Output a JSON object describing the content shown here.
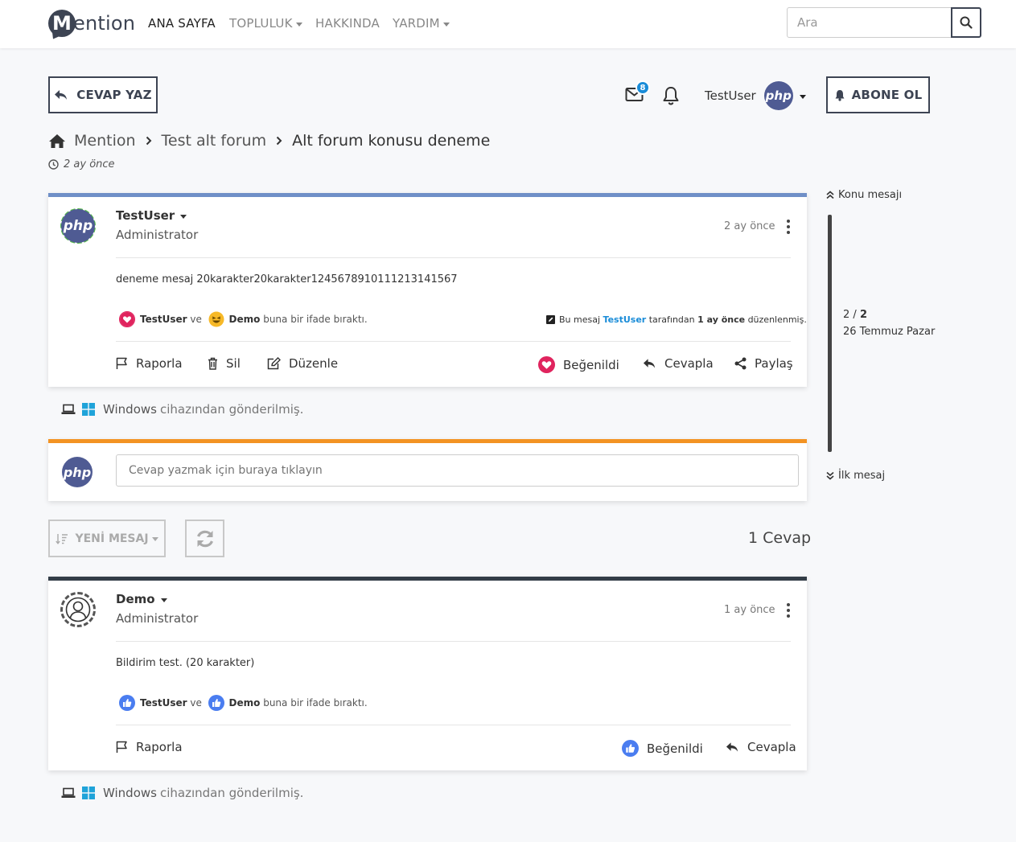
{
  "nav": {
    "logo": "Mention",
    "items": [
      "ANA SAYFA",
      "TOPLULUK",
      "HAKKINDA",
      "YARDIM"
    ],
    "search_placeholder": "Ara"
  },
  "header": {
    "reply_button": "CEVAP YAZ",
    "message_count": "8",
    "username": "TestUser",
    "subscribe_button": "ABONE OL"
  },
  "breadcrumb": {
    "home": "Mention",
    "forum": "Test alt forum",
    "topic": "Alt forum konusu deneme",
    "time": "2 ay önce"
  },
  "posts": [
    {
      "user": "TestUser",
      "role": "Administrator",
      "avatar_text": "php",
      "time": "2 ay önce",
      "text": "deneme mesaj 20karakter20karakter1245678910111213141567",
      "react_user1": "TestUser",
      "react_and": "ve",
      "react_user2": "Demo",
      "react_suffix": "buna bir ifade bıraktı.",
      "edit_prefix": "Bu mesaj",
      "edit_user": "TestUser",
      "edit_middle": "tarafından",
      "edit_time": "1 ay önce",
      "edit_suffix": "düzenlenmiş.",
      "actions": {
        "report": "Raporla",
        "delete": "Sil",
        "edit": "Düzenle",
        "liked": "Beğenildi",
        "reply": "Cevapla",
        "share": "Paylaş"
      },
      "device": "Windows",
      "device_suffix": "cihazından gönderilmiş."
    },
    {
      "user": "Demo",
      "role": "Administrator",
      "time": "1 ay önce",
      "text": "Bildirim test. (20 karakter)",
      "react_user1": "TestUser",
      "react_and": "ve",
      "react_user2": "Demo",
      "react_suffix": "buna bir ifade bıraktı.",
      "actions": {
        "report": "Raporla",
        "liked": "Beğenildi",
        "reply": "Cevapla"
      },
      "device": "Windows",
      "device_suffix": "cihazından gönderilmiş."
    }
  ],
  "quick_reply": {
    "placeholder": "Cevap yazmak için buraya tıklayın",
    "avatar_text": "php"
  },
  "sort": {
    "label": "YENİ MESAJ",
    "reply_count": "1 Cevap"
  },
  "sidebar": {
    "top": "Konu mesajı",
    "position_current": "2",
    "position_sep": "/",
    "position_total": "2",
    "date": "26 Temmuz Pazar",
    "bottom": "İlk mesaj"
  },
  "colors": {
    "accent": "#3d4453",
    "link": "#1a8cd8",
    "post1_bar": "#6f8fc7",
    "reply_bar": "#f39323",
    "post2_bar": "#333d47",
    "like": "#e0245e",
    "thumb": "#4a7df0"
  }
}
